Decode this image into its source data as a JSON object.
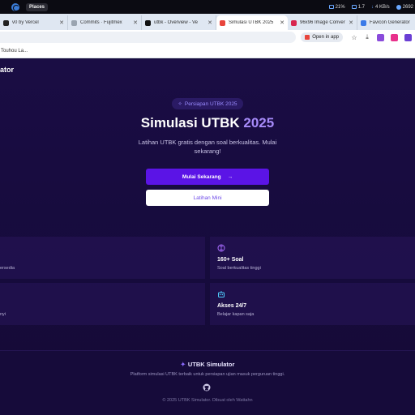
{
  "os_bar": {
    "workspace_label": "Places",
    "stats": [
      "21%",
      "1.7",
      "4 KB/s",
      "2692"
    ]
  },
  "tabs": [
    {
      "title": "v0 by Vercel",
      "favicon_color": "#222222"
    },
    {
      "title": "Commits · Fujitmex",
      "favicon_color": "#9aa4b0"
    },
    {
      "title": "utbk - Overview - Ve",
      "favicon_color": "#111111"
    },
    {
      "title": "Simulasi UTBK 2025",
      "favicon_color": "#e8453c",
      "active": true
    },
    {
      "title": "96x96 Image Conver",
      "favicon_color": "#d8264f"
    },
    {
      "title": "Favicon Generator",
      "favicon_color": "#3c7be8"
    }
  ],
  "toolbar": {
    "open_in_app_label": "Open in app"
  },
  "bookmarks": {
    "items": [
      "Touhou La..."
    ]
  },
  "page": {
    "brand": "ator",
    "hero": {
      "badge": "Persiapan UTBK 2025",
      "title_main": "Simulasi UTBK ",
      "title_highlight": "2025",
      "subtitle": "Latihan UTBK gratis dengan soal berkualitas. Mulai sekarang!",
      "primary_button": "Mulai Sekarang",
      "secondary_button": "Latihan Mini"
    },
    "features": [
      {
        "title": "",
        "desc": "ersedia",
        "icon": ""
      },
      {
        "title": "160+ Soal",
        "desc": "Soal berkualitas tinggi",
        "icon": "brain-icon"
      },
      {
        "title": "",
        "desc": "nyi",
        "icon": ""
      },
      {
        "title": "Akses 24/7",
        "desc": "Belajar kapan saja",
        "icon": "robot-icon"
      }
    ],
    "footer": {
      "title": "UTBK Simulator",
      "subtitle": "Platform simulasi UTBK terbaik untuk persiapan ujian masuk perguruan tinggi.",
      "copyright": "© 2025 UTBK Simulator. Dibuat oleh Wattahn"
    }
  },
  "colors": {
    "accent": "#5b14e6",
    "highlight": "#a78bfa",
    "background": "#1a0d44"
  }
}
